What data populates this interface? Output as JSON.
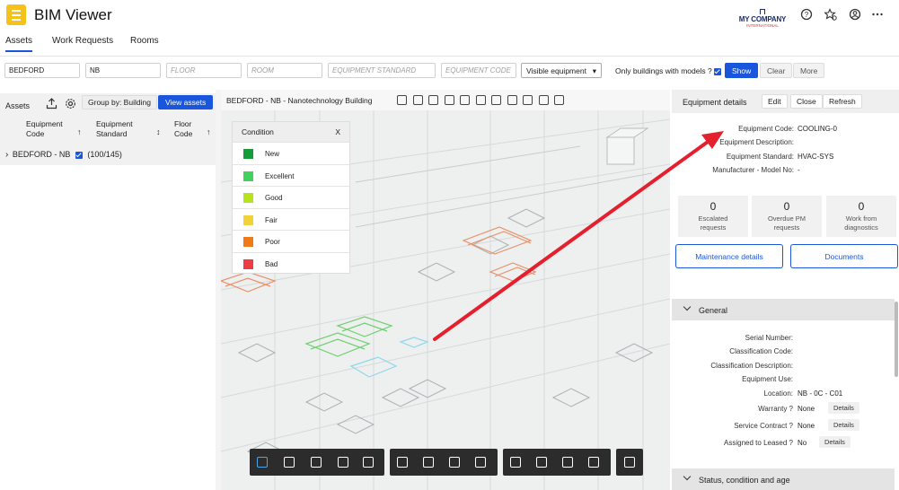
{
  "app": {
    "title": "BIM Viewer",
    "company_line1": "MY COMPANY",
    "company_line2": "INTERNATIONAL"
  },
  "tabs": [
    "Assets",
    "Work Requests",
    "Rooms"
  ],
  "filters": {
    "building": "BEDFORD",
    "level": "NB",
    "floor_placeholder": "FLOOR",
    "room_placeholder": "ROOM",
    "equipment_standard_placeholder": "EQUIPMENT STANDARD",
    "equipment_code_placeholder": "EQUIPMENT CODE",
    "visible_select": "Visible equipment",
    "only_buildings_label": "Only buildings with models ?",
    "show": "Show",
    "clear": "Clear",
    "more": "More"
  },
  "assets_panel": {
    "title": "Assets",
    "group_by": "Group by: Building",
    "view_assets": "View assets",
    "columns": [
      {
        "line1": "Equipment",
        "line2": "Code"
      },
      {
        "line1": "Equipment",
        "line2": "Standard"
      },
      {
        "line1": "Floor",
        "line2": "Code"
      }
    ],
    "tree_item": "BEDFORD - NB",
    "tree_count": "(100/145)"
  },
  "viewer": {
    "title": "BEDFORD - NB - Nanotechnology Building",
    "condition": {
      "title": "Condition",
      "close": "X",
      "items": [
        {
          "label": "New",
          "color": "#159c3a"
        },
        {
          "label": "Excellent",
          "color": "#43d15d"
        },
        {
          "label": "Good",
          "color": "#b6e31c"
        },
        {
          "label": "Fair",
          "color": "#f2d23a"
        },
        {
          "label": "Poor",
          "color": "#f07a18"
        },
        {
          "label": "Bad",
          "color": "#ee3b44"
        }
      ]
    }
  },
  "details": {
    "title": "Equipment details",
    "edit": "Edit",
    "close": "Close",
    "refresh": "Refresh",
    "fields": [
      {
        "key": "Equipment Code:",
        "value": "COOLING-0"
      },
      {
        "key": "Equipment Description:",
        "value": ""
      },
      {
        "key": "Equipment Standard:",
        "value": "HVAC-SYS"
      },
      {
        "key": "Manufacturer - Model No:",
        "value": "-"
      }
    ],
    "tiles": [
      {
        "num": "0",
        "l1": "Escalated",
        "l2": "requests"
      },
      {
        "num": "0",
        "l1": "Overdue PM",
        "l2": "requests"
      },
      {
        "num": "0",
        "l1": "Work from",
        "l2": "diagnostics"
      }
    ],
    "maintenance_button": "Maintenance details",
    "documents_button": "Documents",
    "general": {
      "title": "General",
      "fields": [
        {
          "key": "Serial Number:",
          "value": ""
        },
        {
          "key": "Classification Code:",
          "value": ""
        },
        {
          "key": "Classification Description:",
          "value": ""
        },
        {
          "key": "Equipment Use:",
          "value": ""
        },
        {
          "key": "Location:",
          "value": "NB - 0C - C01"
        },
        {
          "key": "Warranty ?",
          "value": "None",
          "details": "Details"
        },
        {
          "key": "Service Contract ?",
          "value": "None",
          "details": "Details"
        },
        {
          "key": "Assigned to Leased ?",
          "value": "No",
          "details": "Details"
        }
      ]
    },
    "status_section": "Status, condition and age"
  }
}
